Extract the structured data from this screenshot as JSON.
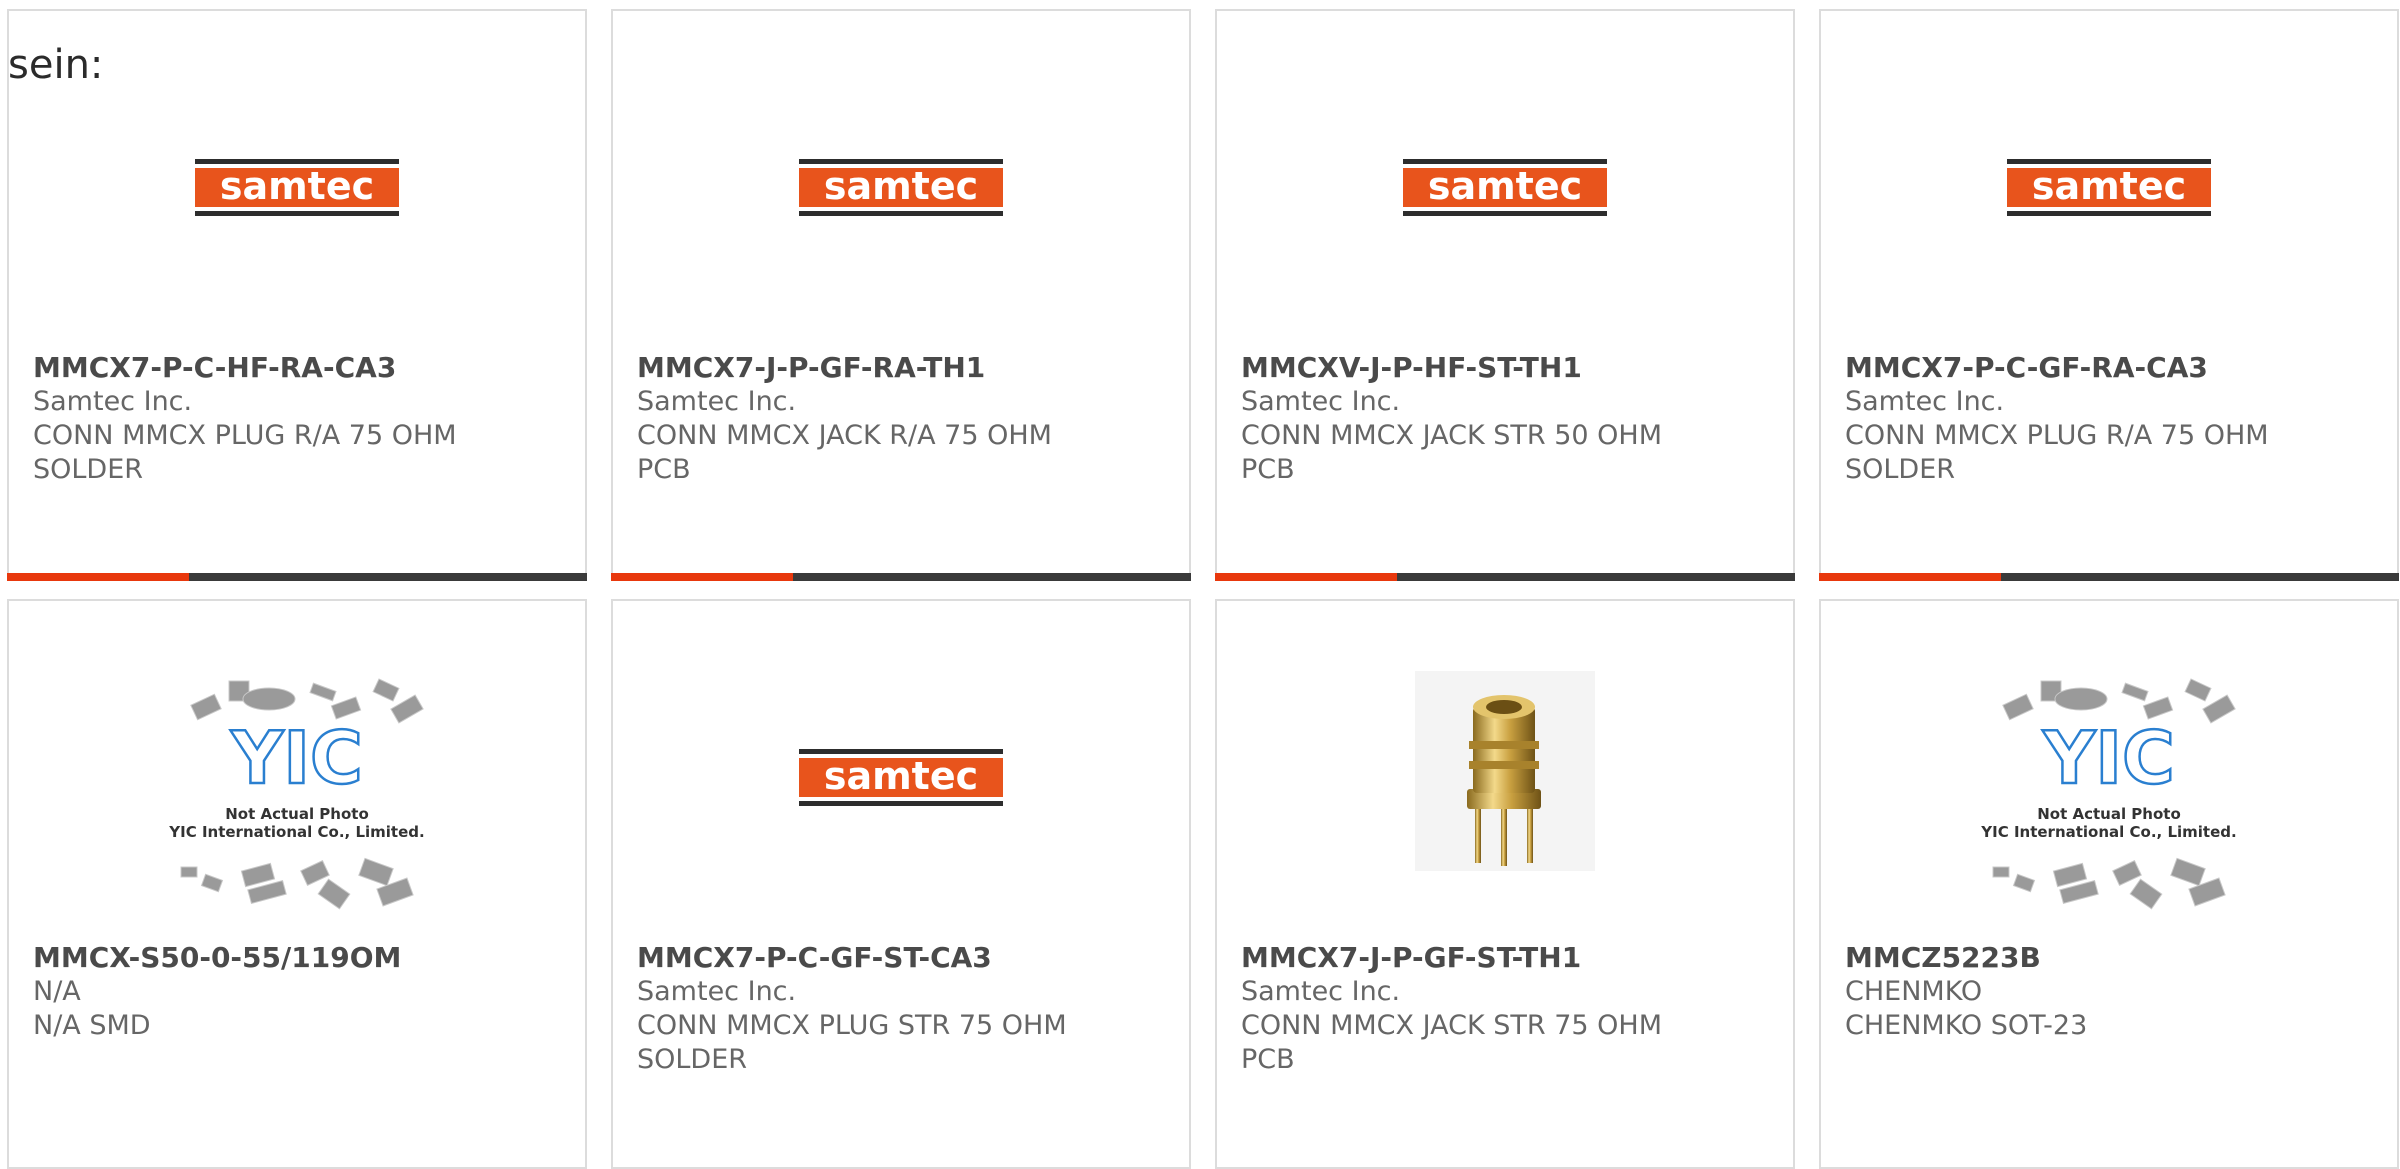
{
  "intro_text": "sein:",
  "colors": {
    "border": "#dcdcdc",
    "accent": "#e8380d",
    "bar_dark": "#3a3a3a",
    "samtec_orange": "#e8541c",
    "yic_blue": "#2a7fd0"
  },
  "logo_texts": {
    "samtec": "samtec",
    "yic_mark": "YIC",
    "yic_line1": "Not Actual Photo",
    "yic_line2": "YIC International Co., Limited."
  },
  "products": [
    {
      "part": "MMCX7-P-C-HF-RA-CA3",
      "maker": "Samtec Inc.",
      "desc": "CONN MMCX PLUG R/A 75 OHM",
      "desc2": "SOLDER",
      "image": "samtec-logo",
      "bar": true
    },
    {
      "part": "MMCX7-J-P-GF-RA-TH1",
      "maker": "Samtec Inc.",
      "desc": "CONN MMCX JACK R/A 75 OHM",
      "desc2": "PCB",
      "image": "samtec-logo",
      "bar": true
    },
    {
      "part": "MMCXV-J-P-HF-ST-TH1",
      "maker": "Samtec Inc.",
      "desc": "CONN MMCX JACK STR 50 OHM",
      "desc2": "PCB",
      "image": "samtec-logo",
      "bar": true
    },
    {
      "part": "MMCX7-P-C-GF-RA-CA3",
      "maker": "Samtec Inc.",
      "desc": "CONN MMCX PLUG R/A 75 OHM",
      "desc2": "SOLDER",
      "image": "samtec-logo",
      "bar": true
    },
    {
      "part": "MMCX-S50-0-55/119OM",
      "maker": "N/A",
      "desc": "N/A SMD",
      "desc2": "",
      "image": "yic-placeholder",
      "bar": false
    },
    {
      "part": "MMCX7-P-C-GF-ST-CA3",
      "maker": "Samtec Inc.",
      "desc": "CONN MMCX PLUG STR 75 OHM",
      "desc2": "SOLDER",
      "image": "samtec-logo",
      "bar": false
    },
    {
      "part": "MMCX7-J-P-GF-ST-TH1",
      "maker": "Samtec Inc.",
      "desc": "CONN MMCX JACK STR 75 OHM",
      "desc2": "PCB",
      "image": "connector-photo",
      "bar": false
    },
    {
      "part": "MMCZ5223B",
      "maker": "CHENMKO",
      "desc": "CHENMKO SOT-23",
      "desc2": "",
      "image": "yic-placeholder",
      "bar": false
    }
  ]
}
